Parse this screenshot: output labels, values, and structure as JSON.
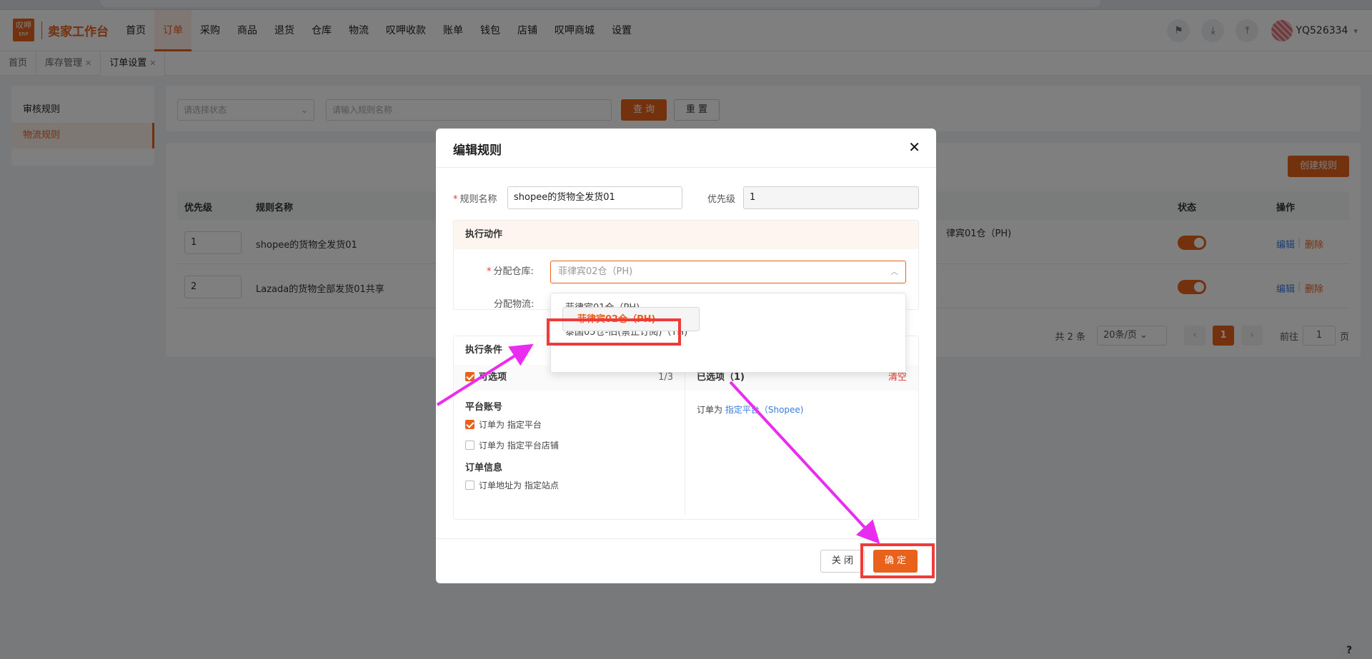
{
  "logo": {
    "mark": "叹呷",
    "mark_sub": "ERP",
    "title": "卖家工作台"
  },
  "nav": [
    "首页",
    "订单",
    "采购",
    "商品",
    "退货",
    "仓库",
    "物流",
    "叹呷收款",
    "账单",
    "钱包",
    "店铺",
    "叹呷商城",
    "设置"
  ],
  "user": {
    "name": "YQ526334"
  },
  "tabs": [
    {
      "label": "首页",
      "closable": false
    },
    {
      "label": "库存管理",
      "closable": true
    },
    {
      "label": "订单设置",
      "closable": true
    }
  ],
  "left_menu": [
    "审核规则",
    "物流规则"
  ],
  "filter": {
    "status_placeholder": "请选择状态",
    "name_placeholder": "请输入规则名称",
    "query": "查 询",
    "reset": "重 置"
  },
  "create_rule": "创建规则",
  "table": {
    "headers": {
      "priority": "优先级",
      "name": "规则名称",
      "status": "状态",
      "ops": "操作"
    },
    "rows": [
      {
        "priority": "1",
        "name": "shopee的货物全发货01",
        "warehouse": "律宾01仓（PH)"
      },
      {
        "priority": "2",
        "name": "Lazada的货物全部发货01共享",
        "warehouse": ""
      }
    ],
    "edit": "编辑",
    "delete": "删除"
  },
  "pager": {
    "total": "共 2 条",
    "page_size": "20条/页",
    "current": "1",
    "goto": "前往",
    "goto_val": "1",
    "page_unit": "页"
  },
  "modal": {
    "title": "编辑规则",
    "rule_name_label": "规则名称",
    "rule_name_value": "shopee的货物全发货01",
    "priority_label": "优先级",
    "priority_value": "1",
    "action_title": "执行动作",
    "warehouse_label": "分配仓库:",
    "warehouse_value": "菲律宾02仓（PH)",
    "logistics_label": "分配物流:",
    "cond_title": "执行条件",
    "optional_title": "可选项",
    "optional_count": "1/3",
    "selected_title": "已选项（1)",
    "clear": "清空",
    "group1": "平台账号",
    "opt1": "订单为 指定平台",
    "opt2": "订单为 指定平台店铺",
    "group2": "订单信息",
    "opt3": "订单地址为 指定站点",
    "selected_prefix": "订单为",
    "selected_value": "指定平台（Shopee)",
    "close": "关 闭",
    "confirm": "确 定"
  },
  "dropdown": [
    "菲律宾01仓（PH)",
    "菲律宾02仓（PH)",
    "泰国05仓-旧(禁止订阅)（TH)"
  ],
  "help": "?",
  "colors": {
    "accent": "#e8621c",
    "highlight": "#f03b3b",
    "arrow": "#ea2cf0"
  }
}
